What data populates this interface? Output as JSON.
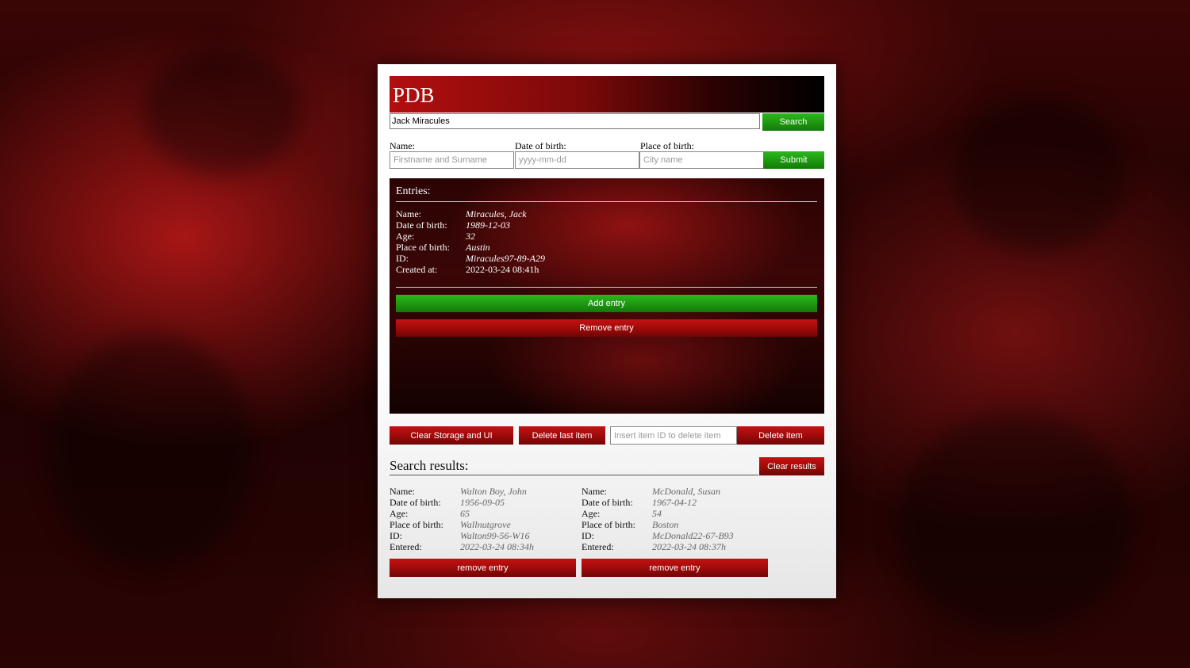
{
  "app": {
    "title": "PDB"
  },
  "search": {
    "value": "Jack Miracules",
    "button_label": "Search"
  },
  "form": {
    "name_label": "Name:",
    "name_placeholder": "Firstname and Surname",
    "dob_label": "Date of birth:",
    "dob_placeholder": "yyyy-mm-dd",
    "pob_label": "Place of birth:",
    "pob_placeholder": "City name",
    "submit_label": "Submit"
  },
  "entries": {
    "title": "Entries:",
    "fields": [
      {
        "label": "Name:",
        "value": "Miracules, Jack"
      },
      {
        "label": "Date of birth:",
        "value": "1989-12-03"
      },
      {
        "label": "Age:",
        "value": "32"
      },
      {
        "label": "Place of birth:",
        "value": "Austin"
      },
      {
        "label": "ID:",
        "value": "Miracules97-89-A29"
      },
      {
        "label": "Created at:",
        "value": "2022-03-24 08:41h"
      }
    ],
    "add_label": "Add entry",
    "remove_label": "Remove entry"
  },
  "controls": {
    "clear_storage_label": "Clear Storage and UI",
    "delete_last_label": "Delete last item",
    "delete_id_placeholder": "Insert item ID to delete item",
    "delete_item_label": "Delete item"
  },
  "results": {
    "title": "Search results:",
    "clear_label": "Clear results",
    "items": [
      {
        "fields": [
          {
            "label": "Name:",
            "value": "Walton Boy, John"
          },
          {
            "label": "Date of birth:",
            "value": "1956-09-05"
          },
          {
            "label": "Age:",
            "value": "65"
          },
          {
            "label": "Place of birth:",
            "value": "Wallnutgrove"
          },
          {
            "label": "ID:",
            "value": "Walton99-56-W16"
          },
          {
            "label": "Entered:",
            "value": "2022-03-24 08:34h"
          }
        ],
        "remove_label": "remove entry"
      },
      {
        "fields": [
          {
            "label": "Name:",
            "value": "McDonald, Susan"
          },
          {
            "label": "Date of birth:",
            "value": "1967-04-12"
          },
          {
            "label": "Age:",
            "value": "54"
          },
          {
            "label": "Place of birth:",
            "value": "Boston"
          },
          {
            "label": "ID:",
            "value": "McDonald22-67-B93"
          },
          {
            "label": "Entered:",
            "value": "2022-03-24 08:37h"
          }
        ],
        "remove_label": "remove entry"
      }
    ]
  }
}
